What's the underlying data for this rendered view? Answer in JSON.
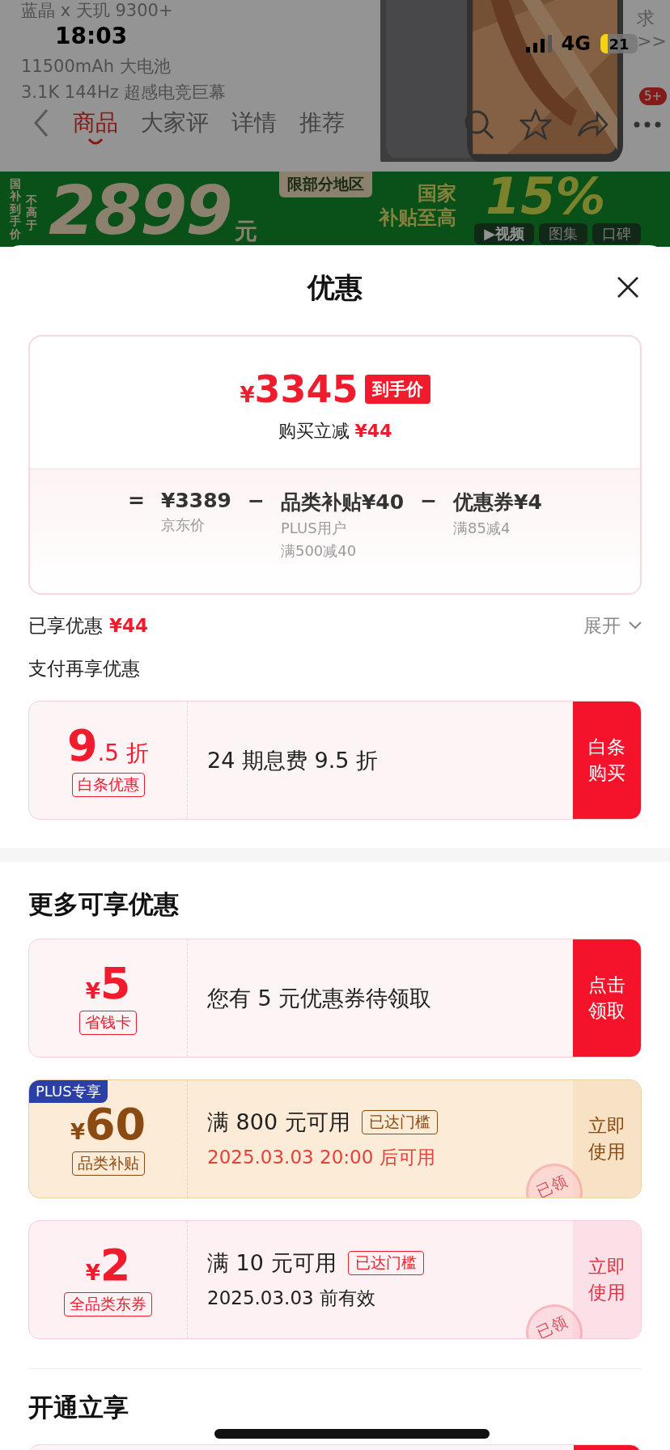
{
  "status_bar": {
    "time": "18:03",
    "network": "4G",
    "battery": "21"
  },
  "background_page": {
    "specs": [
      "蓝晶 x 天玑 9300+",
      "11500mAh 大电池",
      "3.1K 144Hz 超感电竞巨幕"
    ],
    "side_hint": [
      "求",
      ">>"
    ],
    "tabs": [
      {
        "label": "商品",
        "selected": true
      },
      {
        "label": "大家评",
        "selected": false
      },
      {
        "label": "详情",
        "selected": false
      },
      {
        "label": "推荐",
        "selected": false
      }
    ],
    "cart_badge": "5+",
    "banner": {
      "vertical_labels": [
        "国补到手价",
        "不高于"
      ],
      "price": "2899",
      "unit": "元",
      "region_tag": "限部分地区",
      "subsidy_label": [
        "国家",
        "补贴至高"
      ],
      "subsidy_rate": "15%",
      "media_tabs": [
        "▶视频",
        "图集",
        "口碑"
      ]
    }
  },
  "sheet": {
    "title": "优惠",
    "price": {
      "currency": "¥",
      "amount": "3345",
      "tag": "到手价",
      "reduction_label": "购买立减",
      "reduction": "¥44",
      "formula": [
        {
          "kind": "symbol",
          "text": "="
        },
        {
          "kind": "term",
          "text": "¥3389",
          "notes": [
            "京东价"
          ]
        },
        {
          "kind": "symbol",
          "text": "−"
        },
        {
          "kind": "term",
          "text": "品类补贴¥40",
          "notes": [
            "PLUS用户",
            "满500减40"
          ]
        },
        {
          "kind": "symbol",
          "text": "−"
        },
        {
          "kind": "term",
          "text": "优惠券¥4",
          "notes": [
            "满85减4"
          ]
        }
      ]
    },
    "savings": {
      "label": "已享优惠",
      "amount": "¥44",
      "toggle": "展开"
    },
    "payment_heading": "支付再享优惠",
    "payment_offers": [
      {
        "kind": "promo",
        "amount": "9",
        "amount_suffix": ".5 折",
        "tag": "白条优惠",
        "title": "24 期息费 9.5 折",
        "action": "白条购买"
      }
    ],
    "more_heading": "更多可享优惠",
    "coupons": [
      {
        "kind": "promo",
        "currency": "¥",
        "amount": "5",
        "tag": "省钱卡",
        "title": "您有 5 元优惠券待领取",
        "action": "点击领取"
      },
      {
        "kind": "plus",
        "badge": "PLUS专享",
        "currency": "¥",
        "amount": "60",
        "tag": "品类补贴",
        "title": "满 800 元可用",
        "threshold": "已达门槛",
        "date": "2025.03.03 20:00 后可用",
        "action": "立即使用",
        "stamp": "已领"
      },
      {
        "kind": "coupon",
        "currency": "¥",
        "amount": "2",
        "tag": "全品类东券",
        "title": "满 10 元可用",
        "threshold": "已达门槛",
        "date": "2025.03.03 前有效",
        "action": "立即使用",
        "stamp": "已领"
      }
    ],
    "open_heading": "开通立享"
  }
}
